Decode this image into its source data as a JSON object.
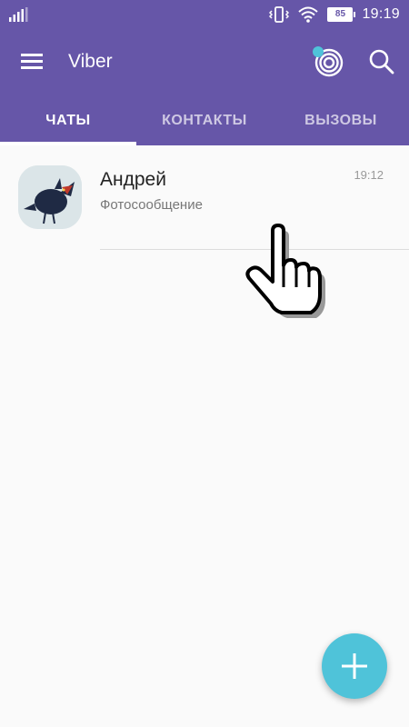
{
  "status_bar": {
    "battery": "85",
    "time": "19:19",
    "icons": [
      "signal-icon",
      "vibrate-icon",
      "wifi-icon",
      "battery-icon"
    ]
  },
  "app_bar": {
    "title": "Viber",
    "icons": [
      "menu-icon",
      "community-icon",
      "search-icon"
    ]
  },
  "tabs": [
    {
      "label": "ЧАТЫ",
      "active": true
    },
    {
      "label": "КОНТАКТЫ",
      "active": false
    },
    {
      "label": "ВЫЗОВЫ",
      "active": false
    }
  ],
  "chats": [
    {
      "name": "Андрей",
      "preview": "Фотосообщение",
      "time": "19:12"
    }
  ],
  "fab": {
    "icon": "plus-icon"
  },
  "colors": {
    "primary": "#6656a8",
    "fab": "#4fc3d9",
    "background": "#fafafa",
    "badge_dot": "#4fc3d9"
  }
}
